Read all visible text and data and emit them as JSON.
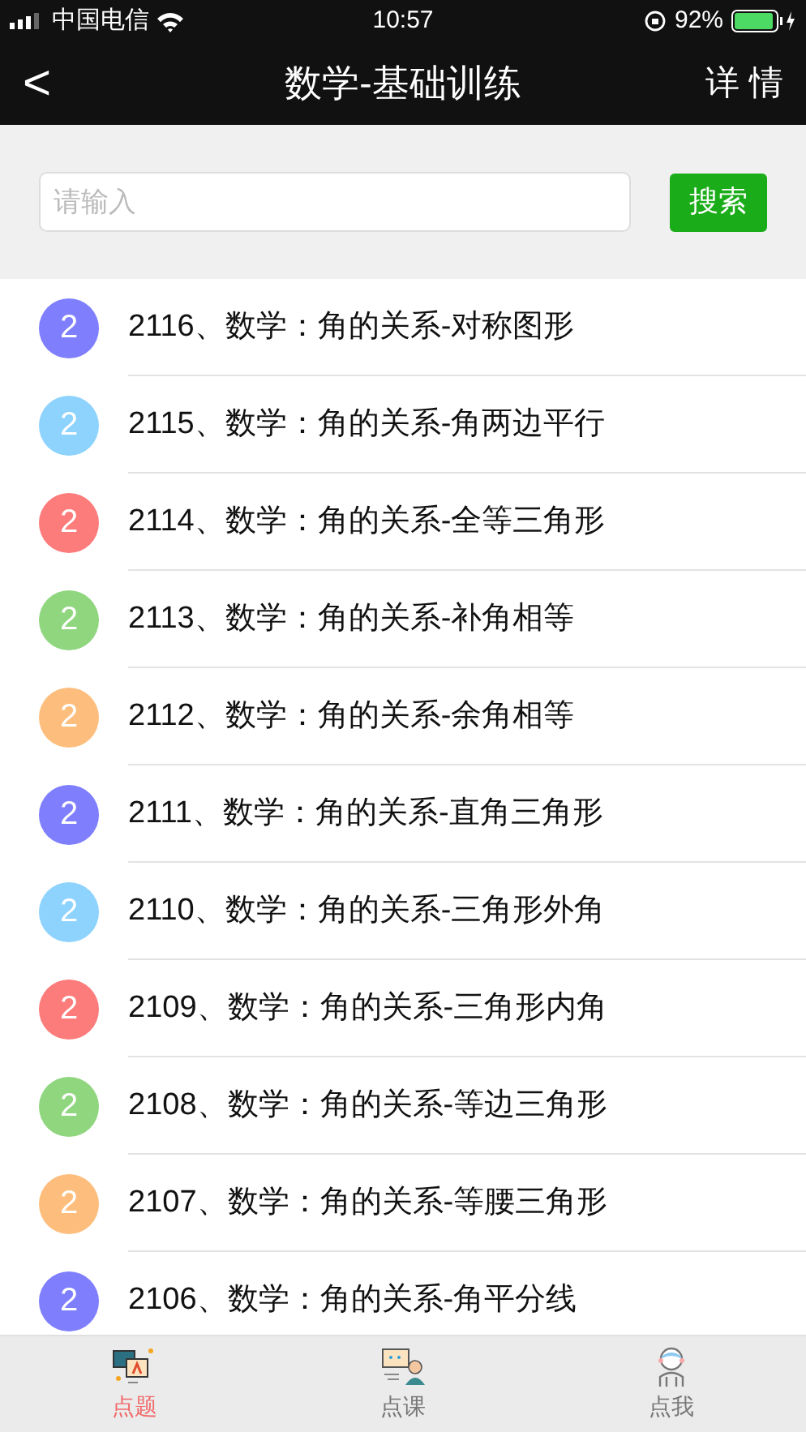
{
  "status_bar": {
    "carrier": "中国电信",
    "time": "10:57",
    "battery": "92%"
  },
  "nav": {
    "back": "<",
    "title": "数学-基础训练",
    "action": "详 情"
  },
  "search": {
    "placeholder": "请输入",
    "button": "搜索"
  },
  "items": [
    {
      "badge": "2",
      "title": "2116、数学：角的关系-对称图形",
      "color": "#7f7ffd"
    },
    {
      "badge": "2",
      "title": "2115、数学：角的关系-角两边平行",
      "color": "#8dd3fd"
    },
    {
      "badge": "2",
      "title": "2114、数学：角的关系-全等三角形",
      "color": "#fc7b7b"
    },
    {
      "badge": "2",
      "title": "2113、数学：角的关系-补角相等",
      "color": "#8fd67f"
    },
    {
      "badge": "2",
      "title": "2112、数学：角的关系-余角相等",
      "color": "#fdbe7d"
    },
    {
      "badge": "2",
      "title": "2111、数学：角的关系-直角三角形",
      "color": "#7f7ffd"
    },
    {
      "badge": "2",
      "title": "2110、数学：角的关系-三角形外角",
      "color": "#8dd3fd"
    },
    {
      "badge": "2",
      "title": "2109、数学：角的关系-三角形内角",
      "color": "#fc7b7b"
    },
    {
      "badge": "2",
      "title": "2108、数学：角的关系-等边三角形",
      "color": "#8fd67f"
    },
    {
      "badge": "2",
      "title": "2107、数学：角的关系-等腰三角形",
      "color": "#fdbe7d"
    },
    {
      "badge": "2",
      "title": "2106、数学：角的关系-角平分线",
      "color": "#7f7ffd"
    }
  ],
  "tabs": [
    {
      "label": "点题",
      "kind": "questions",
      "selected": true
    },
    {
      "label": "点课",
      "kind": "lessons",
      "selected": false
    },
    {
      "label": "点我",
      "kind": "me",
      "selected": false
    }
  ]
}
